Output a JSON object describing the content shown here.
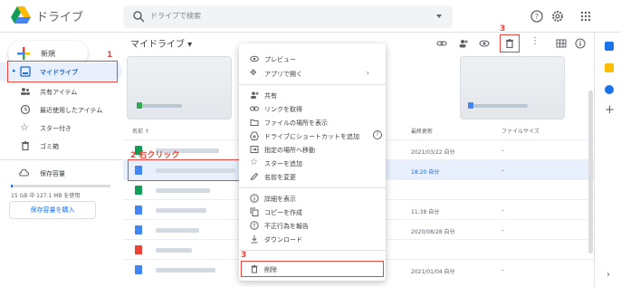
{
  "app": {
    "name": "ドライブ",
    "logo_icon": "drive-logo-icon"
  },
  "search": {
    "placeholder": "ドライブで検索"
  },
  "topbar_icons": [
    "help-icon",
    "settings-icon",
    "apps-grid-icon"
  ],
  "sidebar": {
    "new_label": "新規",
    "items": [
      {
        "label": "マイドライブ",
        "icon": "my-drive-icon",
        "selected": true
      },
      {
        "label": "共有アイテム",
        "icon": "shared-icon"
      },
      {
        "label": "最近使用したアイテム",
        "icon": "recent-icon"
      },
      {
        "label": "スター付き",
        "icon": "star-icon"
      },
      {
        "label": "ゴミ箱",
        "icon": "trash-icon"
      }
    ],
    "storage_label": "保存容量",
    "storage_text": "15 GB 中 127.1 MB を使用",
    "storage_fraction": 0.008,
    "buy_label": "保存容量を購入"
  },
  "main": {
    "breadcrumb": "マイドライブ ▾",
    "headers": {
      "name": "名前 ↑",
      "modified": "最終更新",
      "size": "ファイルサイズ"
    },
    "rows": [
      {
        "type": "sheet",
        "modified": "2021/03/22 自分",
        "size": "–"
      },
      {
        "type": "doc",
        "modified": "18:20 自分",
        "size": "–",
        "selected": true
      },
      {
        "type": "sheet",
        "modified": "",
        "size": ""
      },
      {
        "type": "doc",
        "modified": "11:38 自分",
        "size": "–"
      },
      {
        "type": "doc",
        "modified": "2020/08/28 自分",
        "size": "–"
      },
      {
        "type": "slides",
        "modified": "",
        "size": ""
      },
      {
        "type": "doc",
        "modified": "2021/01/04 自分",
        "size": "–"
      }
    ]
  },
  "context_menu": {
    "items": [
      {
        "label": "プレビュー",
        "icon": "eye-icon"
      },
      {
        "label": "アプリで開く",
        "icon": "open-with-icon",
        "submenu": "›"
      },
      {
        "label": "共有",
        "icon": "person-add-icon"
      },
      {
        "label": "リンクを取得",
        "icon": "link-icon"
      },
      {
        "label": "ファイルの場所を表示",
        "icon": "folder-icon"
      },
      {
        "label": "ドライブにショートカットを追加",
        "icon": "shortcut-icon",
        "help": "?"
      },
      {
        "label": "指定の場所へ移動",
        "icon": "move-icon"
      },
      {
        "label": "スターを追加",
        "icon": "star-icon"
      },
      {
        "label": "名前を変更",
        "icon": "pencil-icon"
      },
      {
        "label": "詳細を表示",
        "icon": "info-icon"
      },
      {
        "label": "コピーを作成",
        "icon": "copy-icon"
      },
      {
        "label": "不正行為を報告",
        "icon": "report-icon"
      },
      {
        "label": "ダウンロード",
        "icon": "download-icon"
      },
      {
        "label": "削除",
        "icon": "trash-icon"
      }
    ]
  },
  "annotations": {
    "step1": "1",
    "step2": "2 右クリック",
    "step3a": "3",
    "step3b": "3"
  },
  "colors": {
    "accent": "#1a73e8",
    "annotation": "#e8453c",
    "selected_bg": "#e8f0fe"
  }
}
